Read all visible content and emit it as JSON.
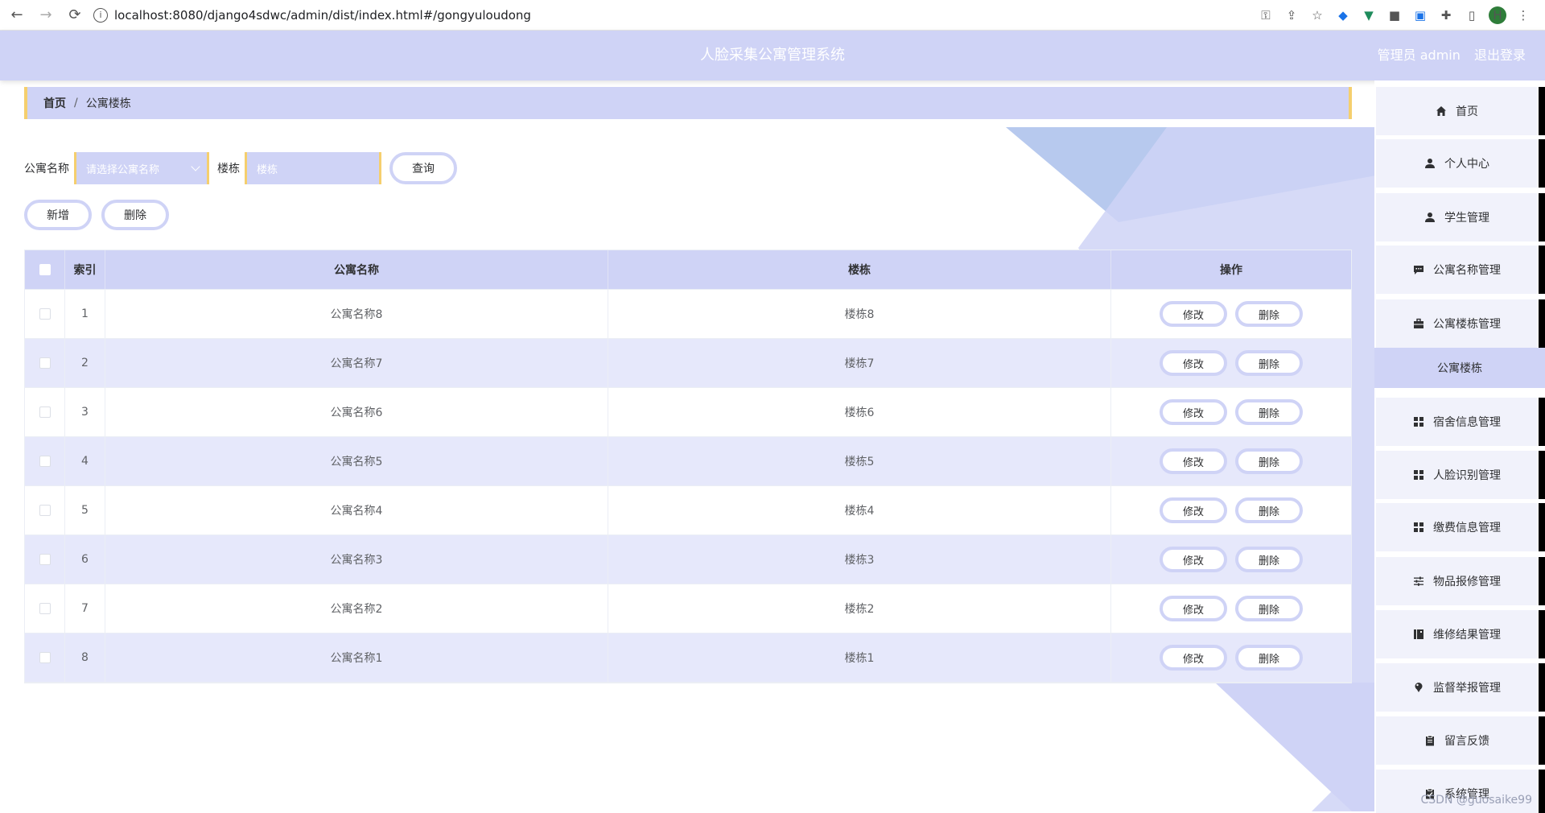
{
  "browser": {
    "url": "localhost:8080/django4sdwc/admin/dist/index.html#/gongyuloudong",
    "avatar_letter": "H"
  },
  "header": {
    "title": "人脸采集公寓管理系统",
    "user_label": "管理员 admin",
    "logout_label": "退出登录"
  },
  "breadcrumb": {
    "home": "首页",
    "separator": "/",
    "current": "公寓楼栋"
  },
  "search": {
    "name_label": "公寓名称",
    "name_placeholder": "请选择公寓名称",
    "floor_label": "楼栋",
    "floor_placeholder": "楼栋",
    "query_label": "查询"
  },
  "actions": {
    "add_label": "新增",
    "delete_label": "删除"
  },
  "table": {
    "headers": {
      "index": "索引",
      "name": "公寓名称",
      "floor": "楼栋",
      "operation": "操作"
    },
    "edit_label": "修改",
    "delete_label": "删除",
    "rows": [
      {
        "index": "1",
        "name": "公寓名称8",
        "floor": "楼栋8"
      },
      {
        "index": "2",
        "name": "公寓名称7",
        "floor": "楼栋7"
      },
      {
        "index": "3",
        "name": "公寓名称6",
        "floor": "楼栋6"
      },
      {
        "index": "4",
        "name": "公寓名称5",
        "floor": "楼栋5"
      },
      {
        "index": "5",
        "name": "公寓名称4",
        "floor": "楼栋4"
      },
      {
        "index": "6",
        "name": "公寓名称3",
        "floor": "楼栋3"
      },
      {
        "index": "7",
        "name": "公寓名称2",
        "floor": "楼栋2"
      },
      {
        "index": "8",
        "name": "公寓名称1",
        "floor": "楼栋1"
      }
    ]
  },
  "menu": {
    "items": [
      {
        "label": "首页",
        "icon": "home-icon"
      },
      {
        "label": "个人中心",
        "icon": "user-icon"
      },
      {
        "label": "学生管理",
        "icon": "user-icon"
      },
      {
        "label": "公寓名称管理",
        "icon": "chat-icon"
      },
      {
        "label": "公寓楼栋管理",
        "icon": "briefcase-icon"
      },
      {
        "label": "公寓楼栋",
        "icon": "",
        "sub": true
      },
      {
        "label": "宿舍信息管理",
        "icon": "grid-icon"
      },
      {
        "label": "人脸识别管理",
        "icon": "grid-icon"
      },
      {
        "label": "缴费信息管理",
        "icon": "grid-icon"
      },
      {
        "label": "物品报修管理",
        "icon": "sliders-icon"
      },
      {
        "label": "维修结果管理",
        "icon": "book-icon"
      },
      {
        "label": "监督举报管理",
        "icon": "pin-icon"
      },
      {
        "label": "留言反馈",
        "icon": "clipboard-icon"
      },
      {
        "label": "系统管理",
        "icon": "clipboard-check-icon"
      }
    ]
  },
  "watermark": "CSDN @guosaike99",
  "colors": {
    "accent": "#cfd3f6",
    "border_accent": "#f5cf6e",
    "stripe": "#e6e8fb"
  }
}
